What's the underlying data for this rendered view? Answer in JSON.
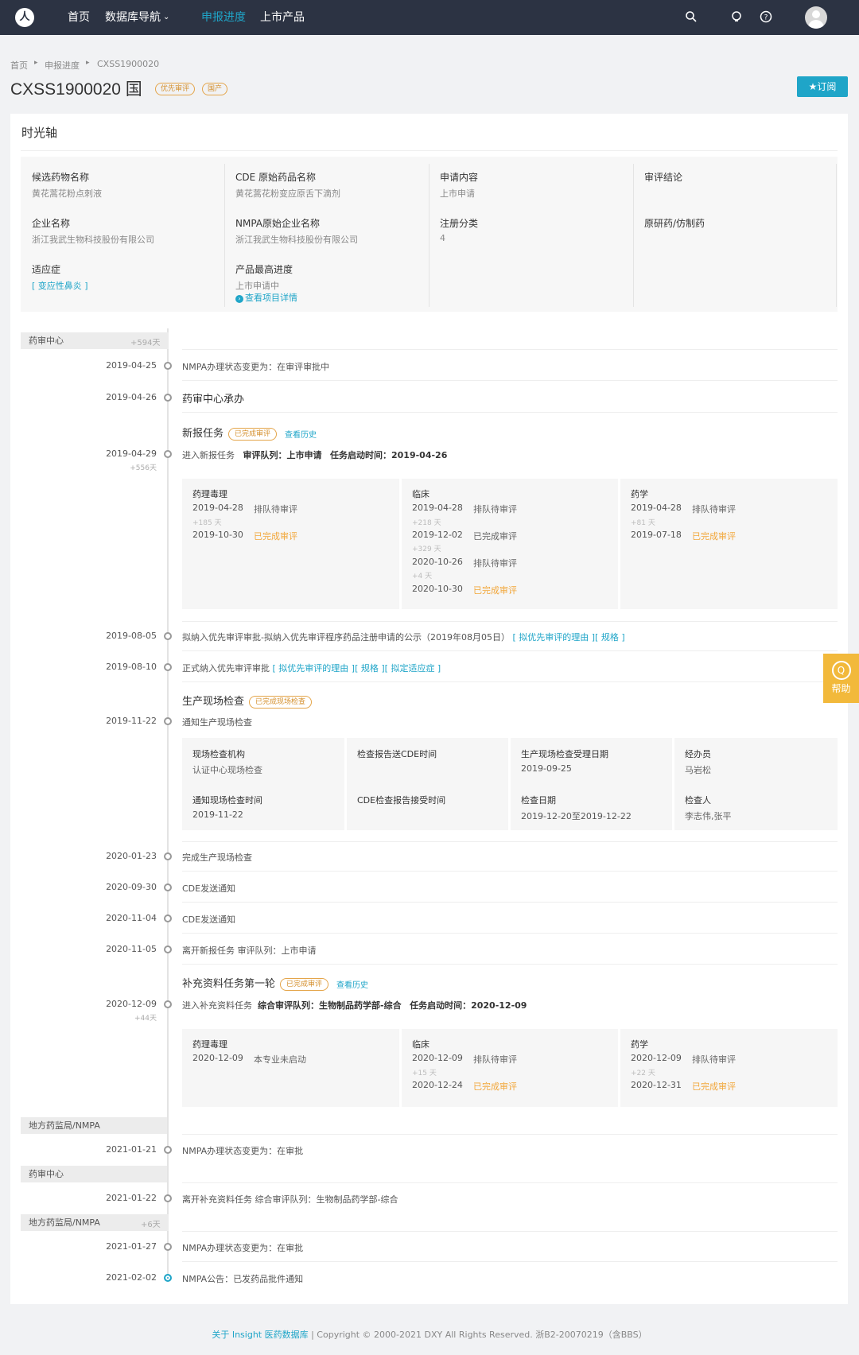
{
  "topbar": {
    "logo": "人",
    "nav": [
      "首页",
      "数据库导航",
      "申报进度",
      "上市产品"
    ],
    "db_caret": "⌄",
    "icons": [
      "search-icon",
      "bulb-icon",
      "help-icon"
    ]
  },
  "breadcrumb": {
    "items": [
      "首页",
      "申报进度",
      "CXSS1900020"
    ],
    "sep": "▸"
  },
  "page": {
    "title": "CXSS1900020 国",
    "tags": [
      "优先审评",
      "国产"
    ],
    "subscribe": "★订阅",
    "section_title": "时光轴"
  },
  "info": {
    "c1": {
      "l1": "候选药物名称",
      "v1": "黄花蒿花粉点刺液",
      "l2": "企业名称",
      "v2": "浙江我武生物科技股份有限公司",
      "l3": "适应症",
      "v3": "[ 变应性鼻炎 ]"
    },
    "c2": {
      "l1": "CDE 原始药品名称",
      "v1": "黄花蒿花粉变应原舌下滴剂",
      "l2": "NMPA原始企业名称",
      "v2": "浙江我武生物科技股份有限公司",
      "l3": "产品最高进度",
      "v3": "上市申请中",
      "detail": "查看项目详情"
    },
    "c3": {
      "l1": "申请内容",
      "v1": "上市申请",
      "l2": "注册分类",
      "v2": "4"
    },
    "c4": {
      "l1": "审评结论",
      "l2": "原研药/仿制药"
    }
  },
  "timeline": {
    "sections": [
      {
        "name": "药审中心",
        "days": "+594天"
      },
      {
        "name": "地方药监局/NMPA",
        "days": ""
      },
      {
        "name": "药审中心",
        "days": ""
      },
      {
        "name": "地方药监局/NMPA",
        "days": "+6天"
      }
    ],
    "events": {
      "e1": {
        "date": "2019-04-25",
        "text": "NMPA办理状态变更为：在审评审批中"
      },
      "e2": {
        "date": "2019-04-26",
        "text": "药审中心承办"
      },
      "task1": {
        "title": "新报任务",
        "status": "已完成审评",
        "history": "查看历史",
        "date": "2019-04-29",
        "days": "+556天",
        "text": "进入新报任务",
        "queue": "审评队列：上市申请",
        "start": "任务启动时间：2019-04-26",
        "cols": [
          {
            "title": "药理毒理",
            "rows": [
              {
                "date": "2019-04-28",
                "status": "排队待审评",
                "plus": "+185 天"
              },
              {
                "date": "2019-10-30",
                "status": "已完成审评",
                "plus": ""
              }
            ]
          },
          {
            "title": "临床",
            "rows": [
              {
                "date": "2019-04-28",
                "status": "排队待审评",
                "plus": "+218 天"
              },
              {
                "date": "2019-12-02",
                "status": "已完成审评",
                "plus": "+329 天"
              },
              {
                "date": "2020-10-26",
                "status": "排队待审评",
                "plus": "+4 天"
              },
              {
                "date": "2020-10-30",
                "status": "已完成审评",
                "plus": ""
              }
            ]
          },
          {
            "title": "药学",
            "rows": [
              {
                "date": "2019-04-28",
                "status": "排队待审评",
                "plus": "+81 天"
              },
              {
                "date": "2019-07-18",
                "status": "已完成审评",
                "plus": ""
              }
            ]
          }
        ]
      },
      "e3": {
        "date": "2019-08-05",
        "text": "拟纳入优先审评审批-拟纳入优先审评程序药品注册申请的公示（2019年08月05日）",
        "links": "[ 拟优先审评的理由 ][ 规格 ]"
      },
      "e4": {
        "date": "2019-08-10",
        "text": "正式纳入优先审评审批",
        "links": "[ 拟优先审评的理由 ][ 规格 ][ 拟定适应症 ]"
      },
      "insp": {
        "title": "生产现场检查",
        "status": "已完成现场检查",
        "date": "2019-11-22",
        "text": "通知生产现场检查",
        "cells": [
          {
            "l": "现场检查机构",
            "v": "认证中心现场检查"
          },
          {
            "l": "检查报告送CDE时间",
            "v": ""
          },
          {
            "l": "生产现场检查受理日期",
            "v": "2019-09-25"
          },
          {
            "l": "经办员",
            "v": "马岩松"
          },
          {
            "l": "通知现场检查时间",
            "v": "2019-11-22"
          },
          {
            "l": "CDE检查报告接受时间",
            "v": ""
          },
          {
            "l": "检查日期",
            "v": "2019-12-20至2019-12-22"
          },
          {
            "l": "检查人",
            "v": "李志伟,张平"
          }
        ]
      },
      "e5": {
        "date": "2020-01-23",
        "text": "完成生产现场检查"
      },
      "e6": {
        "date": "2020-09-30",
        "text": "CDE发送通知"
      },
      "e7": {
        "date": "2020-11-04",
        "text": "CDE发送通知"
      },
      "e8": {
        "date": "2020-11-05",
        "text": "离开新报任务   审评队列：上市申请"
      },
      "task2": {
        "title": "补充资料任务第一轮",
        "status": "已完成审评",
        "history": "查看历史",
        "date": "2020-12-09",
        "days": "+44天",
        "text": "进入补充资料任务",
        "queue": "综合审评队列：生物制品药学部-综合",
        "start": "任务启动时间：2020-12-09",
        "cols": [
          {
            "title": "药理毒理",
            "rows": [
              {
                "date": "2020-12-09",
                "status": "本专业未启动",
                "plus": ""
              }
            ]
          },
          {
            "title": "临床",
            "rows": [
              {
                "date": "2020-12-09",
                "status": "排队待审评",
                "plus": "+15 天"
              },
              {
                "date": "2020-12-24",
                "status": "已完成审评",
                "plus": ""
              }
            ]
          },
          {
            "title": "药学",
            "rows": [
              {
                "date": "2020-12-09",
                "status": "排队待审评",
                "plus": "+22 天"
              },
              {
                "date": "2020-12-31",
                "status": "已完成审评",
                "plus": ""
              }
            ]
          }
        ]
      },
      "e9": {
        "date": "2021-01-21",
        "text": "NMPA办理状态变更为：在审批"
      },
      "e10": {
        "date": "2021-01-22",
        "text": "离开补充资料任务   综合审评队列：生物制品药学部-综合"
      },
      "e11": {
        "date": "2021-01-27",
        "text": "NMPA办理状态变更为：在审批"
      },
      "e12": {
        "date": "2021-02-02",
        "text": "NMPA公告：已发药品批件通知"
      }
    }
  },
  "help": {
    "icon": "Q",
    "label": "帮助"
  },
  "footer": {
    "link": "关于 Insight 医药数据库",
    "text": "| Copyright © 2000-2021 DXY All Rights Reserved. 浙B2-20070219（含BBS）"
  },
  "colors": {
    "accent": "#1fa5c8",
    "header": "#2c3343",
    "done": "#f2a73b"
  }
}
